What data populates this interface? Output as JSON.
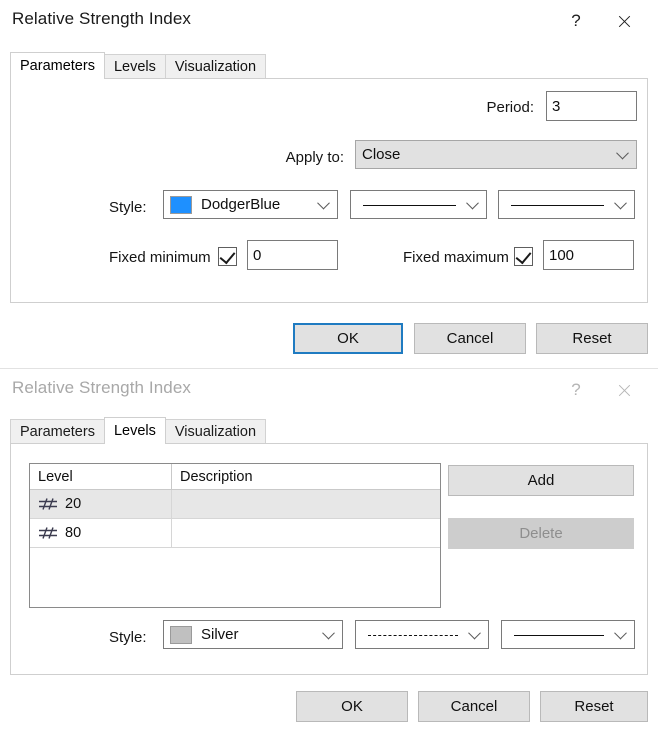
{
  "front_dialog": {
    "title": "Relative Strength Index",
    "help_label": "?",
    "close_icon": "close-icon",
    "tabs": [
      {
        "label": "Parameters",
        "selected": true
      },
      {
        "label": "Levels",
        "selected": false
      },
      {
        "label": "Visualization",
        "selected": false
      }
    ],
    "fields": {
      "period_label": "Period:",
      "period_value": "3",
      "apply_to_label": "Apply to:",
      "apply_to_value": "Close",
      "style_label": "Style:",
      "style_color_name": "DodgerBlue",
      "style_color_hex": "#1E90FF",
      "style_line_pattern": "solid",
      "style_line_width": "solid",
      "fixed_minimum_label": "Fixed minimum",
      "fixed_minimum_checked": true,
      "fixed_minimum_value": "0",
      "fixed_maximum_label": "Fixed maximum",
      "fixed_maximum_checked": true,
      "fixed_maximum_value": "100"
    },
    "buttons": {
      "ok": "OK",
      "cancel": "Cancel",
      "reset": "Reset",
      "ok_focused": true
    }
  },
  "back_dialog": {
    "title": "Relative Strength Index",
    "help_label": "?",
    "close_icon": "close-icon",
    "inactive": true,
    "tabs": [
      {
        "label": "Parameters",
        "selected": false
      },
      {
        "label": "Levels",
        "selected": true
      },
      {
        "label": "Visualization",
        "selected": false
      }
    ],
    "levels_table": {
      "columns": [
        "Level",
        "Description"
      ],
      "rows": [
        {
          "icon": "level-line-icon",
          "level": "20",
          "description": "",
          "selected": true
        },
        {
          "icon": "level-line-icon",
          "level": "80",
          "description": "",
          "selected": false
        }
      ]
    },
    "side_buttons": {
      "add": "Add",
      "delete": "Delete",
      "delete_disabled": true
    },
    "fields": {
      "style_label": "Style:",
      "style_color_name": "Silver",
      "style_color_hex": "#C0C0C0",
      "style_line_pattern": "dashed",
      "style_line_width": "solid"
    },
    "buttons": {
      "ok": "OK",
      "cancel": "Cancel",
      "reset": "Reset",
      "ok_focused": false
    }
  }
}
